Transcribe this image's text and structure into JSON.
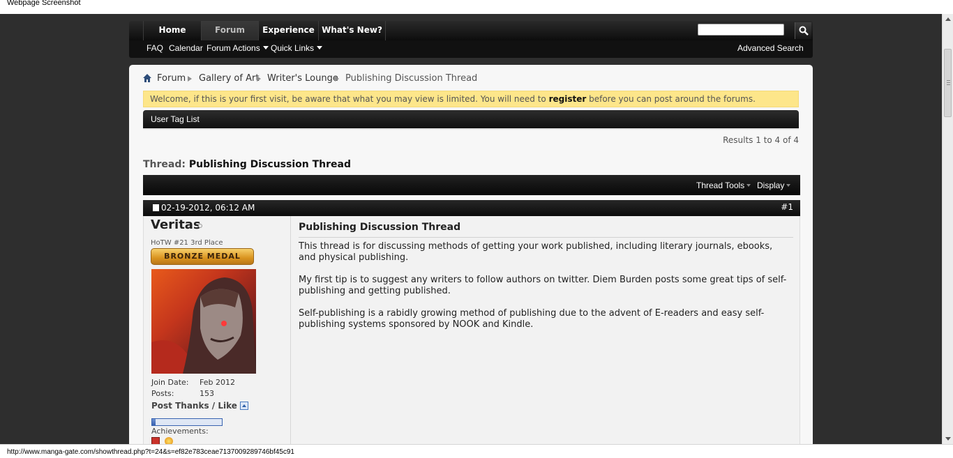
{
  "window": {
    "title": "Webpage Screenshot"
  },
  "status_url": "http://www.manga-gate.com/showthread.php?t=24&s=ef82e783ceae7137009289746bf45c91",
  "nav": {
    "tabs": [
      {
        "label": "Home",
        "active": false
      },
      {
        "label": "Forum",
        "active": true
      },
      {
        "label": "Experience",
        "active": false
      },
      {
        "label": "What's New?",
        "active": false
      }
    ],
    "search_placeholder": "",
    "subnav": [
      "FAQ",
      "Calendar",
      "Forum Actions",
      "Quick Links"
    ],
    "advanced_search": "Advanced Search"
  },
  "breadcrumb": [
    "Forum",
    "Gallery of Art",
    "Writer's Lounge",
    "Publishing Discussion Thread"
  ],
  "notice": {
    "before": "Welcome, if this is your first visit, be aware that what you may view is limited. You will need to ",
    "link": "register",
    "after": " before you can post around the forums."
  },
  "usertag_label": "User Tag List",
  "results": "Results 1 to 4 of 4",
  "thread": {
    "prefix": "Thread:",
    "title": "Publishing Discussion Thread"
  },
  "toolbar": {
    "thread_tools": "Thread Tools",
    "display": "Display"
  },
  "post": {
    "date": "02-19-2012, 06:12 AM",
    "number": "#1",
    "username": "Veritas",
    "user_title": "HoTW #21 3rd Place",
    "medal": "BRONZE MEDAL",
    "join_label": "Join Date:",
    "join_value": "Feb 2012",
    "posts_label": "Posts:",
    "posts_value": "153",
    "thanks_label": "Post Thanks / Like",
    "thanks_fill_fraction": 0.05,
    "achievements_label": "Achievements:",
    "title": "Publishing Discussion Thread",
    "paragraphs": [
      "This thread is for discussing methods of getting your work published, including literary journals, ebooks, and physical publishing.",
      "My first tip is to suggest any writers to follow authors on twitter. Diem Burden posts some great tips of self-publishing and getting published.",
      "Self-publishing is a rabidly growing method of publishing due to the advent of E-readers and easy self-publishing systems sponsored by NOOK and Kindle."
    ]
  },
  "colors": {
    "page_bg": "#2e2e2e",
    "notice_bg": "#fde68a",
    "nav_bg": "#111111",
    "medal": "#d9931f",
    "thanks_bar": "#3963b0"
  },
  "icons": [
    "home-icon",
    "breadcrumb-arrow-icon",
    "search-icon",
    "document-icon",
    "online-status-icon",
    "achievement-icon",
    "caret-down-icon"
  ]
}
